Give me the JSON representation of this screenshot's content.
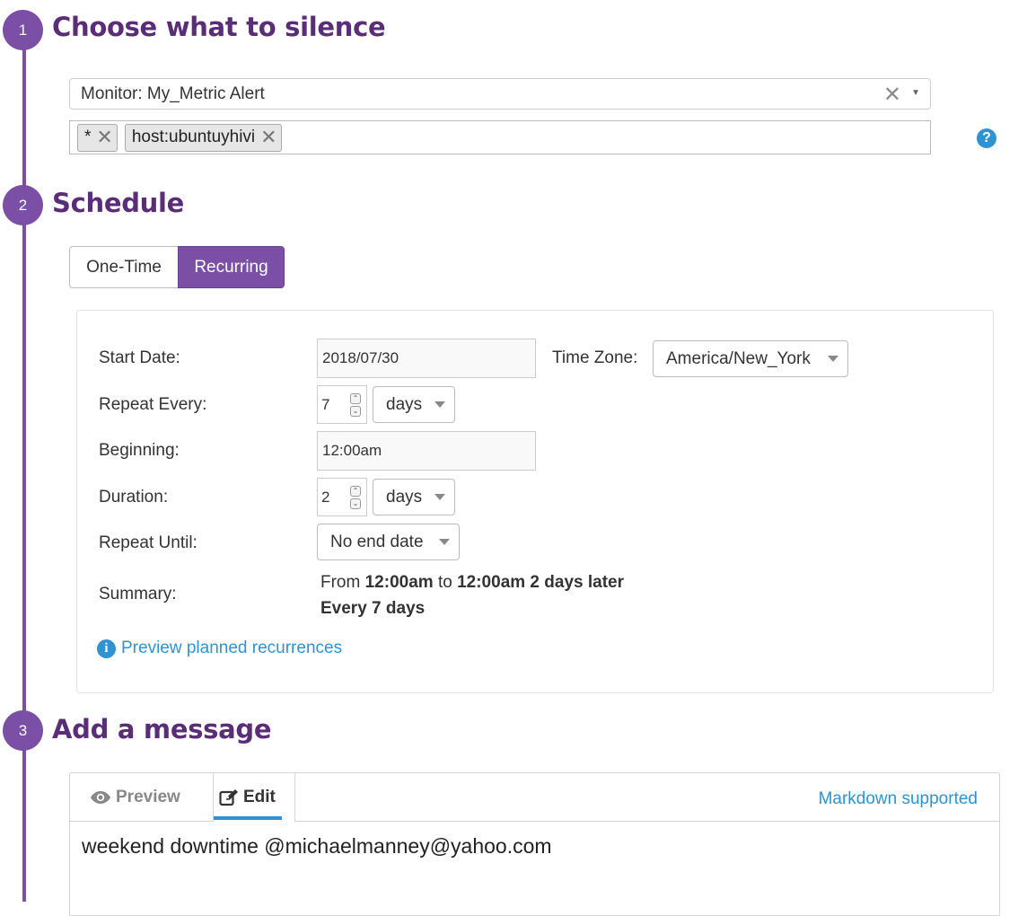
{
  "steps": [
    {
      "number": "1",
      "title": "Choose what to silence"
    },
    {
      "number": "2",
      "title": "Schedule"
    },
    {
      "number": "3",
      "title": "Add a message"
    }
  ],
  "silence": {
    "monitor_value": "Monitor: My_Metric Alert",
    "scope_tags": [
      "*",
      "host:ubuntuyhivi"
    ]
  },
  "schedule": {
    "tabs": {
      "one_time": "One-Time",
      "recurring": "Recurring"
    },
    "active_tab": "Recurring",
    "start_date": {
      "label": "Start Date:",
      "value": "2018/07/30"
    },
    "time_zone": {
      "label": "Time Zone:",
      "value": "America/New_York"
    },
    "repeat_every": {
      "label": "Repeat Every:",
      "value": "7",
      "unit": "days"
    },
    "beginning": {
      "label": "Beginning:",
      "value": "12:00am"
    },
    "duration": {
      "label": "Duration:",
      "value": "2",
      "unit": "days"
    },
    "repeat_until": {
      "label": "Repeat Until:",
      "value": "No end date"
    },
    "summary": {
      "label": "Summary:",
      "from_text": "From",
      "start_time": "12:00am",
      "to_text": "to",
      "end_text": "12:00am 2 days later",
      "every_text": "Every 7 days"
    },
    "preview_link": "Preview planned recurrences"
  },
  "message": {
    "tab_preview": "Preview",
    "tab_edit": "Edit",
    "markdown_link": "Markdown supported",
    "text": "weekend downtime @michaelmanney@yahoo.com"
  },
  "icons": {
    "clear": "close-icon",
    "dropdown": "chevron-down-icon",
    "help": "question-circle-icon",
    "info": "info-circle-icon",
    "preview": "eye-icon",
    "edit": "pencil-square-icon"
  },
  "colors": {
    "accent_purple": "#7b4fa6",
    "heading_purple": "#5a2d77",
    "link_blue": "#2f93d1"
  }
}
